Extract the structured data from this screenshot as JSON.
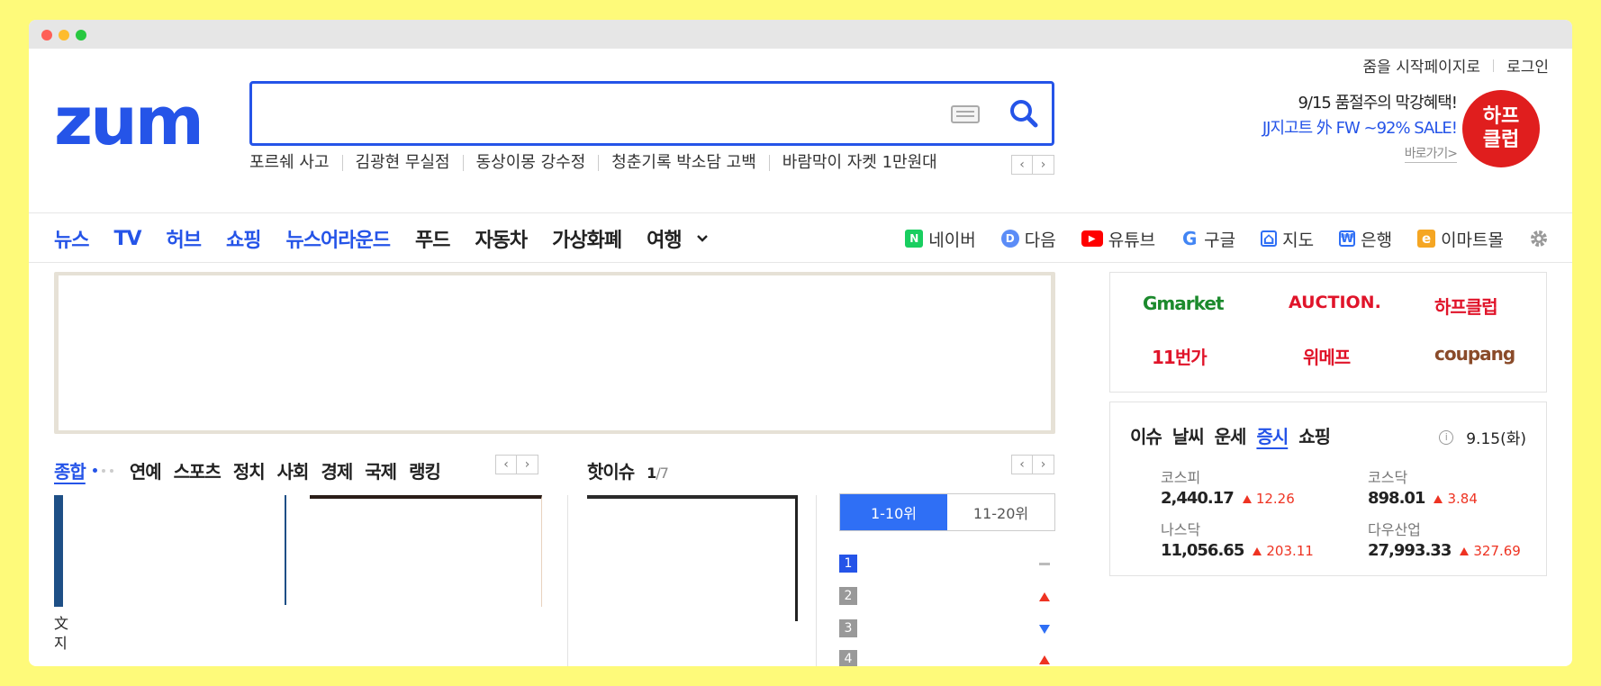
{
  "header": {
    "start_page": "줌을 시작페이지로",
    "login": "로그인",
    "logo": "zum",
    "search_placeholder": "",
    "trends": [
      "포르쉐 사고",
      "김광현 무실점",
      "동상이몽 강수정",
      "청춘기록 박소담 고백",
      "바람막이 자켓 1만원대"
    ],
    "ad": {
      "line1": "9/15 품절주의 막강혜택!",
      "line2": "JJ지고트 外 FW ~92% SALE!",
      "link": "바로가기>",
      "badge": "하프\n클럽"
    }
  },
  "nav": {
    "categories": [
      {
        "label": "뉴스",
        "style": "blue"
      },
      {
        "label": "TV",
        "style": "blue"
      },
      {
        "label": "허브",
        "style": "blue"
      },
      {
        "label": "쇼핑",
        "style": "blue"
      },
      {
        "label": "뉴스어라운드",
        "style": "blue"
      },
      {
        "label": "푸드",
        "style": "dark"
      },
      {
        "label": "자동차",
        "style": "dark"
      },
      {
        "label": "가상화폐",
        "style": "dark"
      },
      {
        "label": "여행",
        "style": "dark"
      }
    ],
    "services": [
      {
        "label": "네이버",
        "icon": "naver-icon",
        "glyph": "N",
        "color": "#19ce60"
      },
      {
        "label": "다음",
        "icon": "daum-icon",
        "glyph": "D",
        "color": "#5b8cf7"
      },
      {
        "label": "유튜브",
        "icon": "youtube-icon",
        "glyph": "▶",
        "color": "#ff0000"
      },
      {
        "label": "구글",
        "icon": "google-icon",
        "glyph": "G",
        "color": "#4285f4"
      },
      {
        "label": "지도",
        "icon": "map-icon",
        "glyph": "⌂",
        "color": "#2f6ff5"
      },
      {
        "label": "은행",
        "icon": "bank-icon",
        "glyph": "₩",
        "color": "#2f6ff5"
      },
      {
        "label": "이마트몰",
        "icon": "emart-icon",
        "glyph": "e",
        "color": "#f5a623"
      }
    ]
  },
  "news": {
    "tabs": [
      "종합",
      "연예",
      "스포츠",
      "정치",
      "사회",
      "경제",
      "국제",
      "랭킹"
    ],
    "active_tab": "종합",
    "thumb_caption_1": "文",
    "thumb_caption_2": "지"
  },
  "hot_issue": {
    "title": "핫이슈",
    "current": "1",
    "total": "/7"
  },
  "ranking": {
    "tabs": [
      "1-10위",
      "11-20위"
    ],
    "rows": [
      {
        "num": "1",
        "trend": "same"
      },
      {
        "num": "2",
        "trend": "up"
      },
      {
        "num": "3",
        "trend": "down"
      },
      {
        "num": "4",
        "trend": "up"
      }
    ]
  },
  "shopping": {
    "logos": [
      {
        "label": "Gmarket",
        "color": "#1c8a2d"
      },
      {
        "label": "AUCTION.",
        "color": "#e0142a"
      },
      {
        "label": "하프클럽",
        "color": "#e0142a"
      },
      {
        "label": "11번가",
        "color": "#e0142a"
      },
      {
        "label": "위메프",
        "color": "#e0142a"
      },
      {
        "label": "coupang",
        "color": "#8a4b2a"
      }
    ]
  },
  "stock": {
    "tabs": [
      "이슈",
      "날씨",
      "운세",
      "증시",
      "쇼핑"
    ],
    "active_tab": "증시",
    "date": "9.15(화)",
    "indices": [
      {
        "name": "코스피",
        "value": "2,440.17",
        "change": "12.26"
      },
      {
        "name": "코스닥",
        "value": "898.01",
        "change": "3.84"
      },
      {
        "name": "나스닥",
        "value": "11,056.65",
        "change": "203.11"
      },
      {
        "name": "다우산업",
        "value": "27,993.33",
        "change": "327.69"
      }
    ]
  }
}
